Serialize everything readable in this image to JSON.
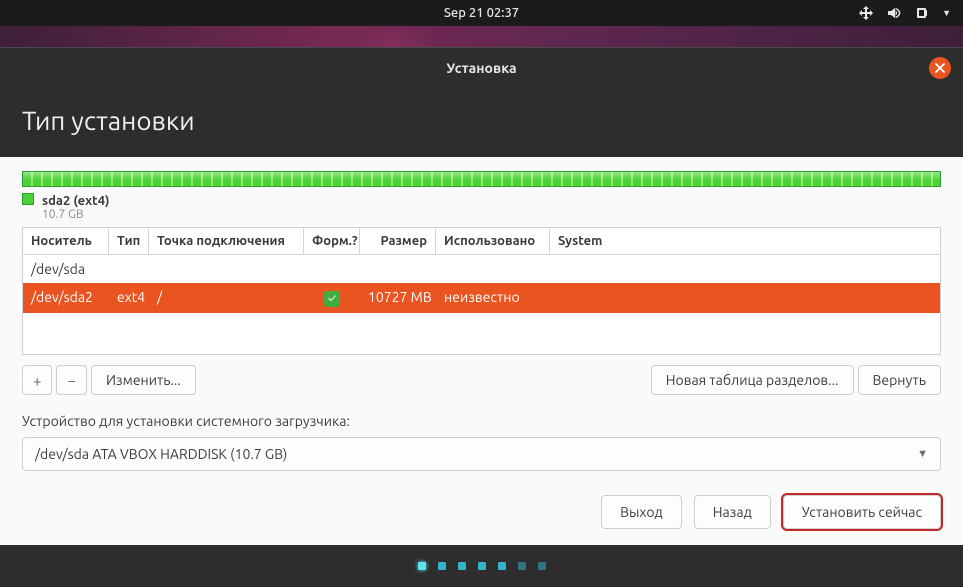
{
  "panel": {
    "datetime": "Sep 21  02:37"
  },
  "window": {
    "title": "Установка",
    "page_title": "Тип установки"
  },
  "disk_legend": {
    "label": "sda2 (ext4)",
    "size": "10.7 GB"
  },
  "columns": {
    "device": "Носитель",
    "type": "Тип",
    "mount": "Точка подключения",
    "format": "Форм.?",
    "size": "Размер",
    "used": "Использовано",
    "system": "System"
  },
  "rows": {
    "disk": {
      "device": "/dev/sda"
    },
    "part": {
      "device": "/dev/sda2",
      "type": "ext4",
      "mount": "/",
      "size": "10727 MB",
      "used": "неизвестно"
    }
  },
  "toolbar": {
    "change": "Изменить...",
    "new_table": "Новая таблица разделов...",
    "revert": "Вернуть"
  },
  "bootloader": {
    "label": "Устройство для установки системного загрузчика:",
    "selected": "/dev/sda   ATA VBOX HARDDISK (10.7 GB)"
  },
  "actions": {
    "quit": "Выход",
    "back": "Назад",
    "install": "Установить сейчас"
  }
}
